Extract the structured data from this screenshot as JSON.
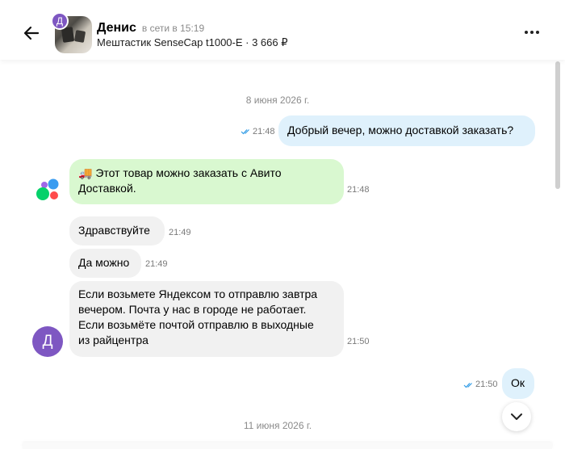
{
  "header": {
    "avatar_letter": "Д",
    "name": "Денис",
    "status": "в сети в 15:19",
    "subject": "Мештастик SenseCap t1000-E · 3 666 ₽",
    "icons": {
      "back": "arrow-left-icon",
      "more": "more-vertical-icon"
    }
  },
  "messages": {
    "date1": "8 июня 2026 г.",
    "m1": {
      "text": "Добрый вечер, можно доставкой заказать?",
      "time": "21:48",
      "direction": "out",
      "read": true
    },
    "m2": {
      "emoji": "🚚",
      "text_line1": "Этот товар можно заказать с Авито",
      "text_line2": "Доставкой.",
      "time": "21:48",
      "direction": "system"
    },
    "m3": {
      "text": "Здравствуйте",
      "time": "21:49",
      "direction": "in"
    },
    "m4": {
      "text": "Да можно",
      "time": "21:49",
      "direction": "in"
    },
    "m5": {
      "line1": "Если возьмете Яндексом то отправлю завтра",
      "line2": "вечером. Почта у нас в городе не работает.",
      "line3": "Если возьмёте почтой отправлю в выходные",
      "line4": "из райцентра",
      "time": "21:50",
      "direction": "in"
    },
    "m6": {
      "text": "Ок",
      "time": "21:50",
      "direction": "out",
      "read": true
    },
    "date2": "11 июня 2026 г."
  },
  "sender_avatar_letter": "Д",
  "colors": {
    "outgoing_bubble": "#dff1fc",
    "incoming_bubble": "#f1f1f1",
    "system_bubble": "#d9f8d0",
    "avatar": "#7e57c2",
    "read_check": "#2f9be6"
  }
}
